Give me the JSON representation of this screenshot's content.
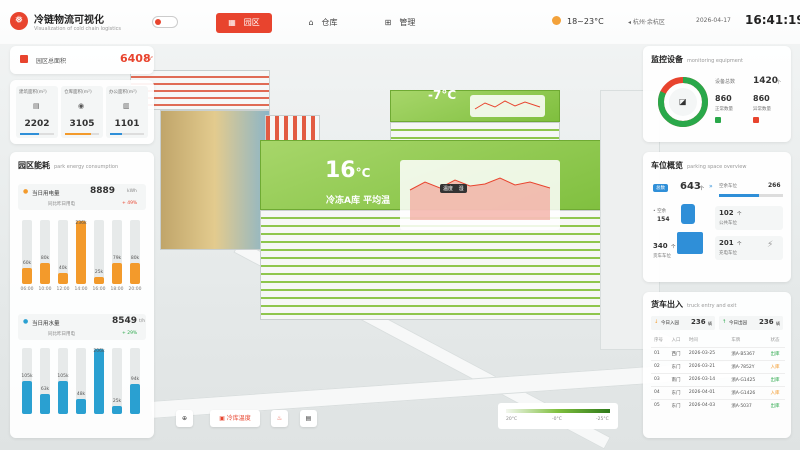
{
  "header": {
    "title": "冷链物流可视化",
    "subtitle": "Visualization of cold chain logistics",
    "nav": [
      {
        "label": "园区",
        "icon": "building-icon",
        "active": true
      },
      {
        "label": "仓库",
        "icon": "warehouse-icon",
        "active": false
      },
      {
        "label": "管理",
        "icon": "grid-icon",
        "active": false
      }
    ],
    "weather": "18~23°C",
    "location": "杭州·余杭区",
    "date": "2026-04-17",
    "time": "16:41:19"
  },
  "area": {
    "label": "园区总面积",
    "value": "6408",
    "unit": "m²",
    "stats": [
      {
        "label": "建筑面积(m²)",
        "value": "2202",
        "accent": "#2f8fd8",
        "fill": 0.55
      },
      {
        "label": "仓库面积(m²)",
        "value": "3105",
        "accent": "#f39a2b",
        "fill": 0.75
      },
      {
        "label": "办公面积(m²)",
        "value": "1101",
        "accent": "#2f8fd8",
        "fill": 0.35
      }
    ]
  },
  "energy": {
    "title": "园区能耗",
    "subtitle": "park energy consumption",
    "power": {
      "label": "当日用电量",
      "value": "8889",
      "unit": "kWh",
      "compare_label": "同比昨日用电",
      "compare_value": "+ 49%",
      "bars": [
        {
          "x": "06:00",
          "label": "60k",
          "value": 60,
          "color": "#f39a2b"
        },
        {
          "x": "10:00",
          "label": "80k",
          "value": 80,
          "color": "#f39a2b"
        },
        {
          "x": "12:00",
          "label": "40k",
          "value": 40,
          "color": "#f39a2b"
        },
        {
          "x": "14:00",
          "label": "236k",
          "value": 236,
          "color": "#f39a2b"
        },
        {
          "x": "16:00",
          "label": "25k",
          "value": 25,
          "color": "#f39a2b"
        },
        {
          "x": "18:00",
          "label": "79k",
          "value": 79,
          "color": "#f39a2b"
        },
        {
          "x": "20:00",
          "label": "80k",
          "value": 80,
          "color": "#f39a2b"
        }
      ],
      "max": 240
    },
    "water": {
      "label": "当日用水量",
      "value": "8549",
      "unit": "t/h",
      "compare_label": "同比昨日用电",
      "compare_value": "+ 29%",
      "bars": [
        {
          "x": "",
          "label": "105k",
          "value": 105,
          "color": "#2aa0d1"
        },
        {
          "x": "",
          "label": "63k",
          "value": 63,
          "color": "#2aa0d1"
        },
        {
          "x": "",
          "label": "105k",
          "value": 105,
          "color": "#2aa0d1"
        },
        {
          "x": "",
          "label": "48k",
          "value": 48,
          "color": "#2aa0d1"
        },
        {
          "x": "",
          "label": "206k",
          "value": 206,
          "color": "#2aa0d1"
        },
        {
          "x": "",
          "label": "25k",
          "value": 25,
          "color": "#2aa0d1"
        },
        {
          "x": "",
          "label": "94k",
          "value": 94,
          "color": "#2aa0d1"
        }
      ],
      "max": 210
    }
  },
  "scene": {
    "big_temp": "16",
    "big_unit": "°C",
    "big_label": "冷冻A库 平均温",
    "small_temp": "-7°C",
    "popup_buttons": [
      "温度",
      "湿"
    ]
  },
  "monitor": {
    "title": "监控设备",
    "subtitle": "monitoring equipment",
    "total_label": "设备总数",
    "total_value": "1420",
    "total_unit": "个",
    "online_value": "860",
    "online_label": "正常数量",
    "fault_value": "860",
    "fault_label": "异常数量",
    "gauge_fill": 0.82
  },
  "parking": {
    "title": "车位概览",
    "subtitle": "parking space overview",
    "total_tag": "总数",
    "total_value": "643",
    "total_unit": "个",
    "free_label": "空余车位",
    "free_value": "266",
    "bars_fill": 0.62,
    "left_top_label": "• 空余",
    "left_top_value": "154",
    "cells": [
      {
        "value": "102",
        "unit": "个",
        "label": "公共车位"
      },
      {
        "value": "340",
        "unit": "个",
        "label": "货车车位"
      },
      {
        "value": "201",
        "unit": "个",
        "label": "充电车位"
      }
    ]
  },
  "truck": {
    "title": "货车出入",
    "subtitle": "truck entry and exit",
    "in_label": "今日入园",
    "in_value": "236",
    "in_unit": "辆",
    "out_label": "今日出园",
    "out_value": "236",
    "out_unit": "辆",
    "headers": [
      "序号",
      "入口",
      "时间",
      "车牌",
      "状态"
    ],
    "rows": [
      [
        "01",
        "西门",
        "2026-03-25",
        "浙A·B5367",
        "出库"
      ],
      [
        "02",
        "东门",
        "2026-03-21",
        "浙A·7852Y",
        "入库"
      ],
      [
        "03",
        "南门",
        "2026-03-14",
        "浙A·G1425",
        "出库"
      ],
      [
        "04",
        "东门",
        "2026-04-01",
        "浙A·G1426",
        "入库"
      ],
      [
        "05",
        "东门",
        "2026-04-03",
        "浙A·5037",
        "出库"
      ]
    ],
    "status_colors": {
      "出库": "#2aa84a",
      "入库": "#f39a2b"
    }
  },
  "toolbar": {
    "button_label": "冷库温度"
  },
  "legend": {
    "min": "20°C",
    "mid": "-0°C",
    "max": "-25°C"
  }
}
